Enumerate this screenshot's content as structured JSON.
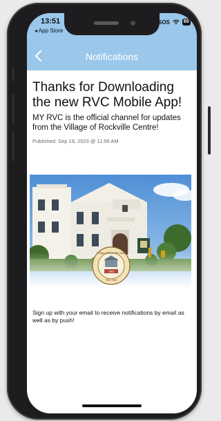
{
  "status_bar": {
    "time": "13:51",
    "back_app": "◂ App Store",
    "sos": "SOS",
    "battery": "65"
  },
  "nav": {
    "title": "Notifications",
    "back_icon": "chevron-left-icon"
  },
  "notification": {
    "title": "Thanks for Downloading the new RVC Mobile App!",
    "description": "MY RVC is the official channel for updates from the Village of Rockville Centre!",
    "published": "Published: Sep 19, 2023 @ 11:56 AM"
  },
  "seal": {
    "name": "Village of Rockville Centre",
    "incorporated": "Incorporated",
    "year": "1893",
    "state": "New York"
  },
  "body_text": "Sign up with your email to receive notifications by email as well as by push!",
  "colors": {
    "header": "#9ac7ea",
    "nav_text": "#ffffff",
    "phone_frame": "#1d1d1f"
  }
}
